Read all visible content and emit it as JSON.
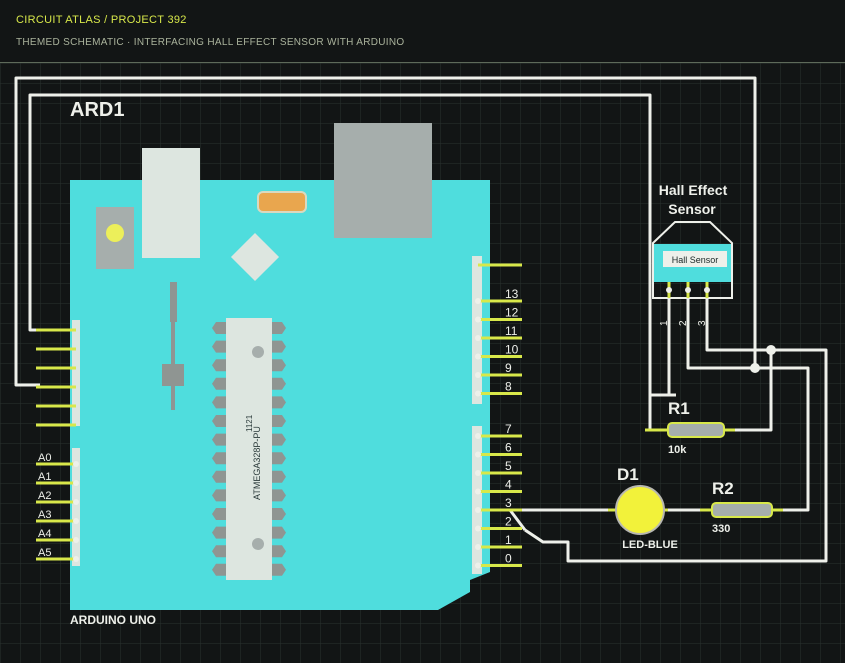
{
  "header": {
    "brand": "CIRCUIT ATLAS / PROJECT 392",
    "subtitle": "THEMED SCHEMATIC · INTERFACING HALL EFFECT SENSOR WITH ARDUINO"
  },
  "arduino": {
    "ref": "ARD1",
    "name": "ARDUINO UNO",
    "chip_label": "ATMEGA328P-PU",
    "chip_code": "1121",
    "digital_pins": [
      "13",
      "12",
      "11",
      "10",
      "9",
      "8",
      "7",
      "6",
      "5",
      "4",
      "3",
      "2",
      "1",
      "0"
    ],
    "analog_pins": [
      "A0",
      "A1",
      "A2",
      "A3",
      "A4",
      "A5"
    ]
  },
  "sensor": {
    "title_line1": "Hall Effect",
    "title_line2": "Sensor",
    "body_label": "Hall Sensor",
    "pins": [
      "1",
      "2",
      "3"
    ]
  },
  "r1": {
    "ref": "R1",
    "value": "10k"
  },
  "r2": {
    "ref": "R2",
    "value": "330"
  },
  "d1": {
    "ref": "D1",
    "value": "LED-BLUE"
  },
  "colors": {
    "background": "#121515",
    "grid": "#2a3230",
    "wire": "#eef0ea",
    "board": "#4fdddd",
    "pin": "#d8e84a",
    "led": "#f2f23a"
  }
}
